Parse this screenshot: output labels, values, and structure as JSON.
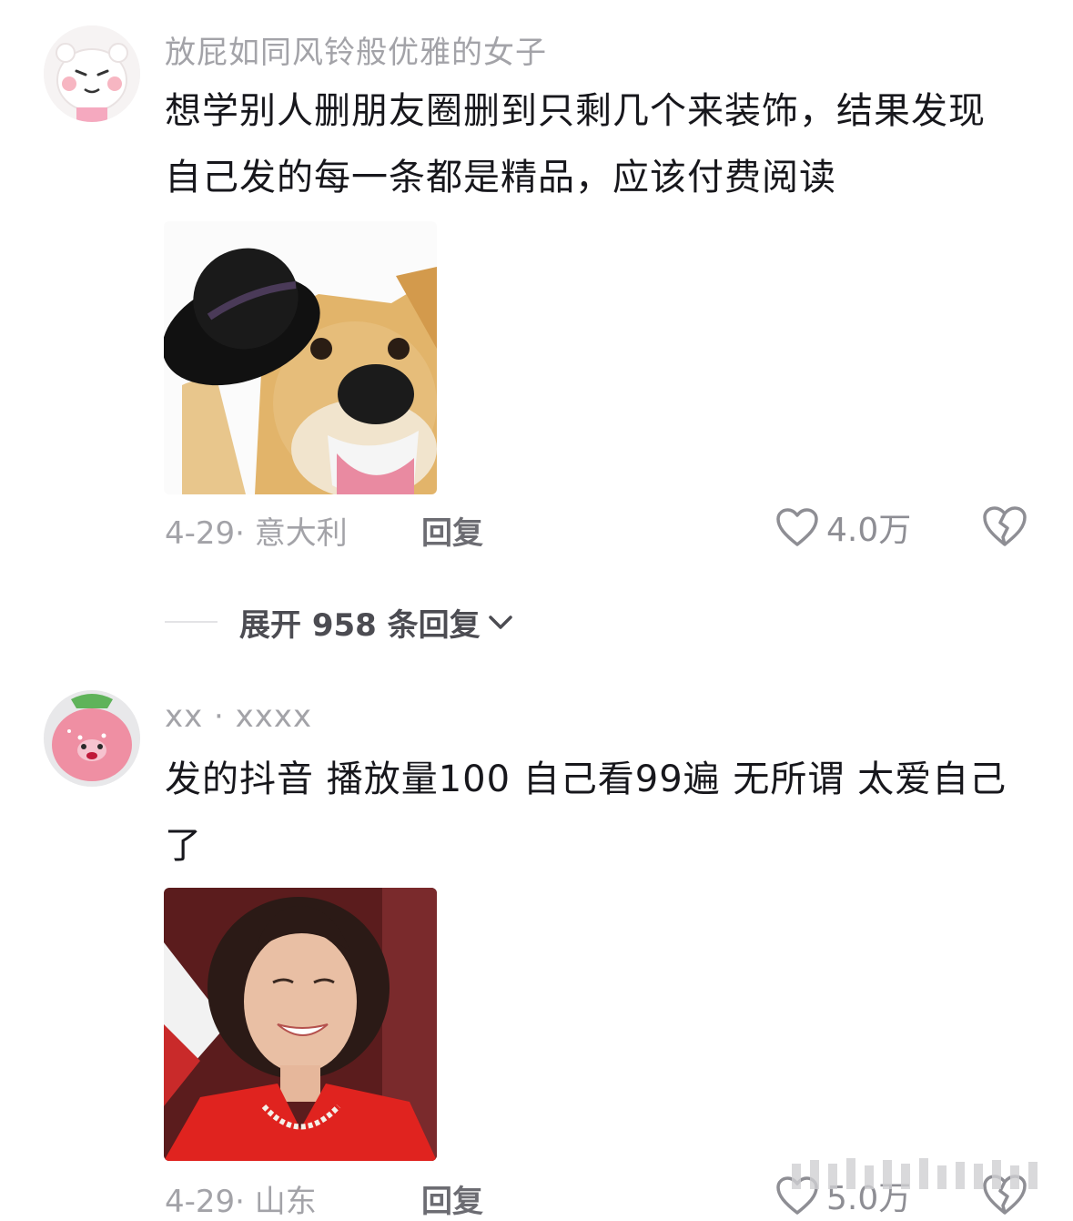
{
  "comments": [
    {
      "username": "放屁如同风铃般优雅的女子",
      "text": "想学别人删朋友圈删到只剩几个来装饰，结果发现自己发的每一条都是精品，应该付费阅读",
      "meta": "4-29· 意大利",
      "reply_label": "回复",
      "likes": "4.0万",
      "avatar_icon": "bear-avatar-icon",
      "meme_icon": "dog-tipping-hat-meme"
    },
    {
      "username": "xx · xxxx",
      "text": "发的抖音 播放量100 自己看99遍 无所谓 太爱自己了",
      "meta": "4-29· 山东",
      "reply_label": "回复",
      "likes": "5.0万",
      "avatar_icon": "pink-loopy-avatar-icon",
      "meme_icon": "woman-laughing-meme"
    }
  ],
  "expand_replies": "展开 958 条回复",
  "colors": {
    "text": "#17171c",
    "muted": "#a3a3a8",
    "accent_red": "#d9262c"
  }
}
